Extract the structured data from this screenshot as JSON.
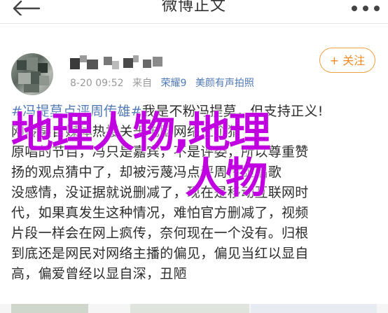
{
  "header": {
    "title": "微博正文"
  },
  "post": {
    "author_time": "8-20 09:52",
    "source_prefix": "来自",
    "device_1": "荣耀9",
    "device_2": "美颜有声拍照",
    "follow_label": "+ 关注",
    "hashtag": "#冯提莫点评周传雄#",
    "lines": [
      "我是不粉冯提莫，但支持正义!",
      "网传某自媒体热搜关于电脑网络上个猜",
      "原唱的节目，冯只是嘉宾，不是评委，所以尊重赞",
      "扬的观点猜中了，却被污蔑冯点评周传雄唱歌",
      "没感情，没证据就说删减了，现在是移动互联网时",
      "代，如果真发生这种情况，难怕官方删减了，视频",
      "片段一样会在网上疯传，奈何现在一个没有。归根",
      "到底还是网民对网络主播的偏见，偏见当红以显自",
      "高，偏爱曾经以显自深，丑陋"
    ]
  },
  "watermark": {
    "line1": "地理人物,地理",
    "line2": "人物"
  },
  "colors": {
    "accent": "#f08a24",
    "link": "#5079b5",
    "watermark": "#c000e0"
  },
  "icons": {
    "back": "back-arrow-icon",
    "more": "more-dots-icon"
  }
}
